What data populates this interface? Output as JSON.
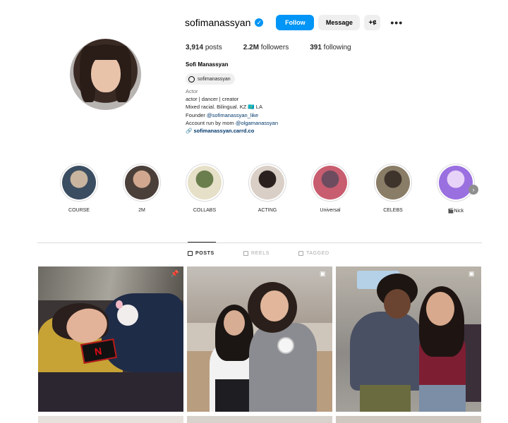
{
  "profile": {
    "username": "sofimanassyan",
    "verified_glyph": "✓",
    "follow_label": "Follow",
    "message_label": "Message",
    "add_user_glyph": "+ዩ",
    "more_glyph": "•••",
    "stats": {
      "posts_count": "3,914",
      "posts_label": "posts",
      "followers_count": "2.2M",
      "followers_label": "followers",
      "following_count": "391",
      "following_label": "following"
    },
    "full_name": "Sofi Manassyan",
    "threads_handle": "sofimanassyan",
    "bio": {
      "category": "Actor",
      "line1": "actor | dancer | creator",
      "line2": "Mixed racial. Bilingual. KZ 🇰🇿 LA",
      "line3_prefix": "Founder ",
      "line3_mention": "@sofimanassyan_like",
      "line4_prefix": "Account run by mom ",
      "line4_mention": "@olgamanassyan",
      "link_glyph": "🔗",
      "link": "sofimanassyan.carrd.co"
    }
  },
  "highlights": [
    {
      "label": "COURSE",
      "color_a": "#3b4d61",
      "color_b": "#c9b59f"
    },
    {
      "label": "2M",
      "color_a": "#4b3f3a",
      "color_b": "#d1a88f"
    },
    {
      "label": "COLLABS",
      "color_a": "#e6e0c8",
      "color_b": "#6a7d4d"
    },
    {
      "label": "ACTING",
      "color_a": "#d9cfc6",
      "color_b": "#2a201d"
    },
    {
      "label": "Universal",
      "color_a": "#c85d6f",
      "color_b": "#6d4c5f"
    },
    {
      "label": "CELEBS",
      "color_a": "#8a7d67",
      "color_b": "#3e342c"
    },
    {
      "label": "🎬Nick",
      "color_a": "#9a6fe0",
      "color_b": "#e7d3f7"
    }
  ],
  "highlights_next_glyph": "›",
  "tabs": [
    {
      "label": "POSTS",
      "active": true
    },
    {
      "label": "REELS",
      "active": false
    },
    {
      "label": "TAGGED",
      "active": false
    }
  ],
  "posts": [
    {
      "overlay_icon": "pin-icon",
      "overlay_glyph": "📌"
    },
    {
      "overlay_icon": "reel-icon",
      "overlay_glyph": "▣"
    },
    {
      "overlay_icon": "reel-icon",
      "overlay_glyph": "▣"
    }
  ],
  "colors": {
    "accent": "#0095f6",
    "link": "#00376b",
    "muted": "#737373",
    "button_gray": "#efefef"
  }
}
